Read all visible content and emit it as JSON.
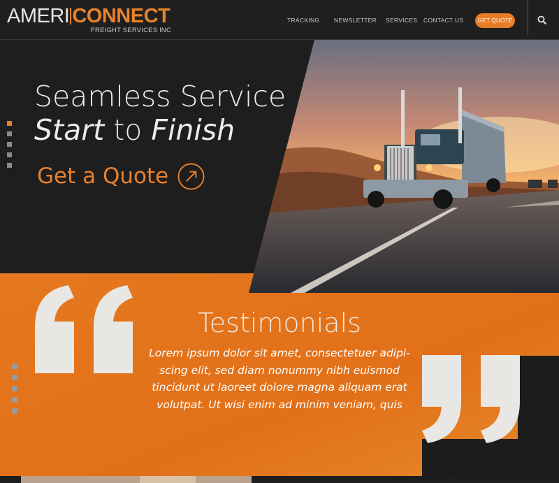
{
  "brand": {
    "name_part1": "AMERI",
    "name_part2": "CONNECT",
    "tagline": "FREIGHT SERVICES INC"
  },
  "nav": {
    "items": [
      "TRACKING",
      "NEWSLETTER",
      "SERVICES",
      "CONTACT US"
    ],
    "cta": "GET QUOTE"
  },
  "hero": {
    "line1": "Seamless Service",
    "line2_a": "Start",
    "line2_b": " to ",
    "line2_c": "Finish",
    "cta_label": "Get a Quote"
  },
  "testimonials": {
    "title": "Testimonials",
    "body": "Lorem ipsum dolor sit amet, consectetuer adipi-scing elit, sed diam nonummy nibh euismod tincidunt ut laoreet dolore magna aliquam erat volutpat. Ut wisi enim ad minim veniam, quis"
  },
  "colors": {
    "accent": "#e8802c",
    "dark": "#1e1e1f",
    "band": "#e0731c",
    "quote_mark": "#e9e7e3"
  },
  "icons": [
    "search-icon",
    "arrow-up-right-icon",
    "open-quote-icon",
    "close-quote-icon"
  ]
}
